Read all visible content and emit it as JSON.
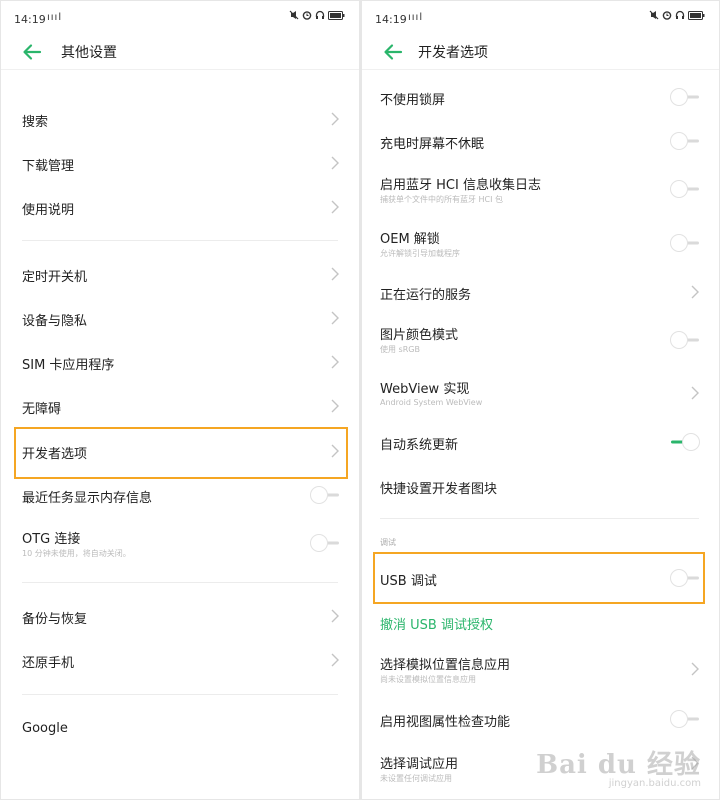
{
  "colors": {
    "accent": "#2ab56b",
    "highlight": "#f5a623"
  },
  "left": {
    "status": {
      "time": "14:19",
      "signal": "ıııl"
    },
    "title": "其他设置",
    "items": [
      {
        "label": "搜索",
        "chevron": true
      },
      {
        "label": "下载管理",
        "chevron": true
      },
      {
        "label": "使用说明",
        "chevron": true
      },
      {
        "label": "定时开关机",
        "chevron": true
      },
      {
        "label": "设备与隐私",
        "chevron": true
      },
      {
        "label": "SIM 卡应用程序",
        "chevron": true
      },
      {
        "label": "无障碍",
        "chevron": true
      },
      {
        "label": "开发者选项",
        "chevron": true
      },
      {
        "label": "最近任务显示内存信息",
        "toggle": "off"
      },
      {
        "label": "OTG 连接",
        "sub": "10 分钟未使用，将自动关闭。",
        "toggle": "off"
      },
      {
        "label": "备份与恢复",
        "chevron": true
      },
      {
        "label": "还原手机",
        "chevron": true
      },
      {
        "label": "Google"
      }
    ]
  },
  "right": {
    "status": {
      "time": "14:19",
      "signal": "ıııl"
    },
    "title": "开发者选项",
    "items": [
      {
        "label": "不使用锁屏",
        "toggle": "off"
      },
      {
        "label": "充电时屏幕不休眠",
        "toggle": "off"
      },
      {
        "label": "启用蓝牙 HCI 信息收集日志",
        "sub": "捕获单个文件中的所有蓝牙 HCI 包",
        "toggle": "off"
      },
      {
        "label": "OEM 解锁",
        "sub": "允许解锁引导加载程序",
        "toggle": "off"
      },
      {
        "label": "正在运行的服务",
        "chevron": true
      },
      {
        "label": "图片颜色模式",
        "sub": "使用 sRGB",
        "toggle": "off"
      },
      {
        "label": "WebView 实现",
        "sub": "Android System WebView",
        "chevron": true
      },
      {
        "label": "自动系统更新",
        "toggle": "on"
      },
      {
        "label": "快捷设置开发者图块"
      },
      {
        "label": "USB 调试",
        "toggle": "off"
      },
      {
        "label": "撤消 USB 调试授权"
      },
      {
        "label": "选择模拟位置信息应用",
        "sub": "尚未设置模拟位置信息应用",
        "chevron": true
      },
      {
        "label": "启用视图属性检查功能",
        "toggle": "off"
      },
      {
        "label": "选择调试应用",
        "sub": "未设置任何调试应用",
        "chevron": true
      }
    ],
    "section": "调试"
  },
  "watermark": {
    "brand": "Bai du 经验",
    "url": "jingyan.baidu.com"
  }
}
